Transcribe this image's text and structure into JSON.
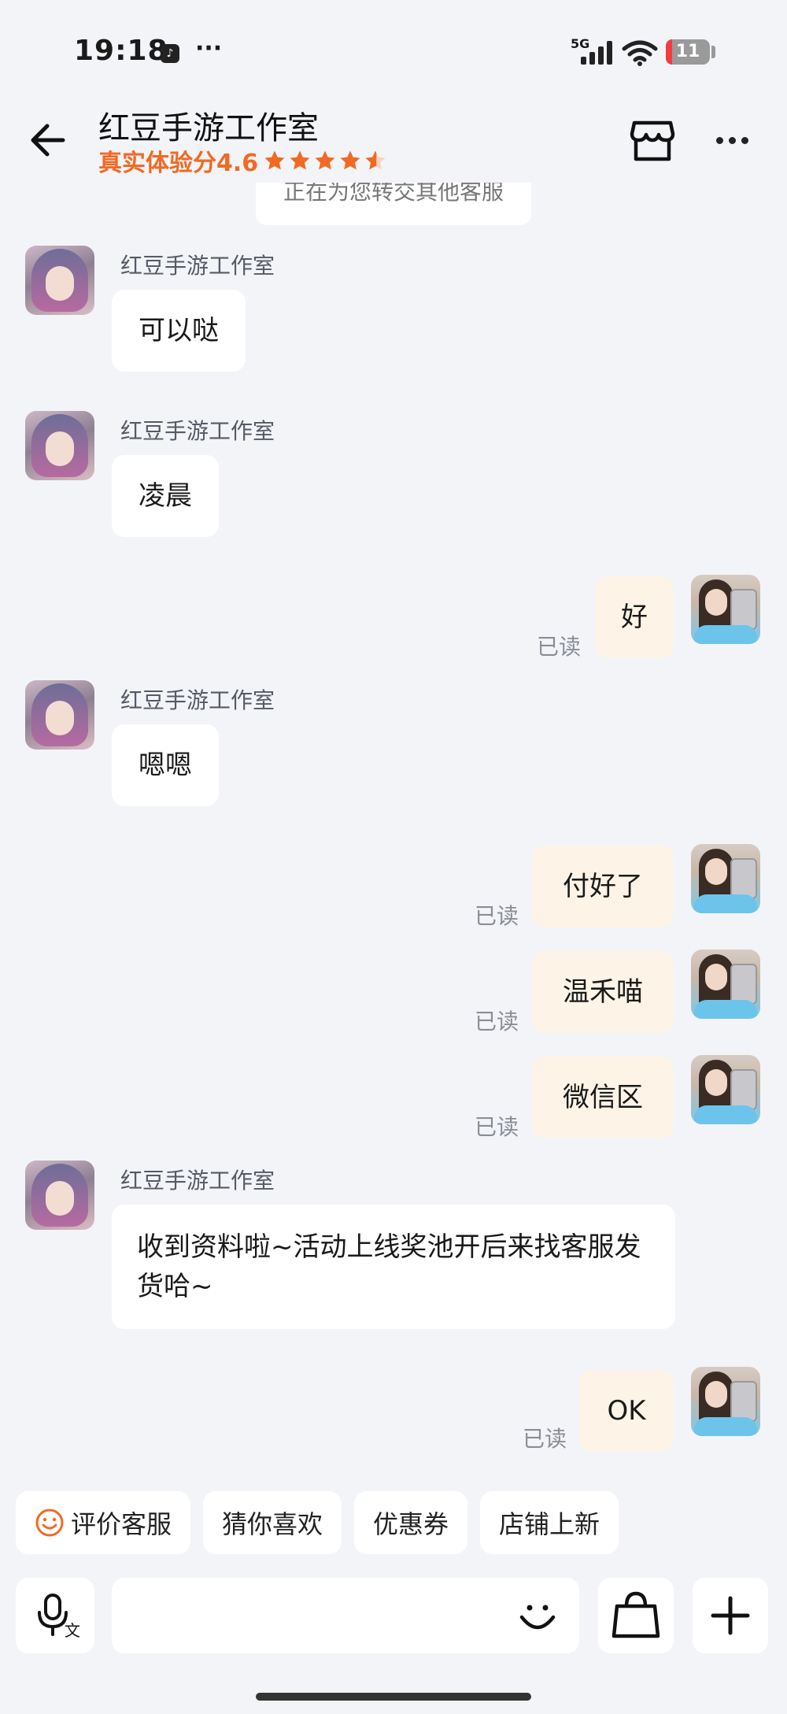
{
  "status_bar": {
    "time": "19:18",
    "network": "5G",
    "battery": "11",
    "overflow": "···"
  },
  "header": {
    "title": "红豆手游工作室",
    "rating_text": "真实体验分4.6",
    "rating_value": 4.6,
    "accent_color": "#f06a23"
  },
  "system_tip": "正在为您转交其他客服",
  "messages": [
    {
      "side": "in",
      "sender": "红豆手游工作室",
      "text": "可以哒"
    },
    {
      "side": "in",
      "sender": "红豆手游工作室",
      "text": "凌晨"
    },
    {
      "side": "out",
      "text": "好",
      "status": "已读"
    },
    {
      "side": "in",
      "sender": "红豆手游工作室",
      "text": "嗯嗯"
    },
    {
      "side": "out",
      "text": "付好了",
      "status": "已读"
    },
    {
      "side": "out",
      "text": "温禾喵",
      "status": "已读"
    },
    {
      "side": "out",
      "text": "微信区",
      "status": "已读"
    },
    {
      "side": "in",
      "sender": "红豆手游工作室",
      "text": "收到资料啦~活动上线奖池开后来找客服发货哈~"
    },
    {
      "side": "out",
      "text": "OK",
      "status": "已读"
    }
  ],
  "quick_actions": [
    "评价客服",
    "猜你喜欢",
    "优惠券",
    "店铺上新"
  ],
  "input": {
    "placeholder": ""
  },
  "icons": {
    "back": "back-arrow-icon",
    "store": "store-icon",
    "more": "more-icon",
    "voice": "voice-translate-icon",
    "emoji": "emoji-icon",
    "bag": "shopping-bag-icon",
    "plus": "plus-icon"
  }
}
